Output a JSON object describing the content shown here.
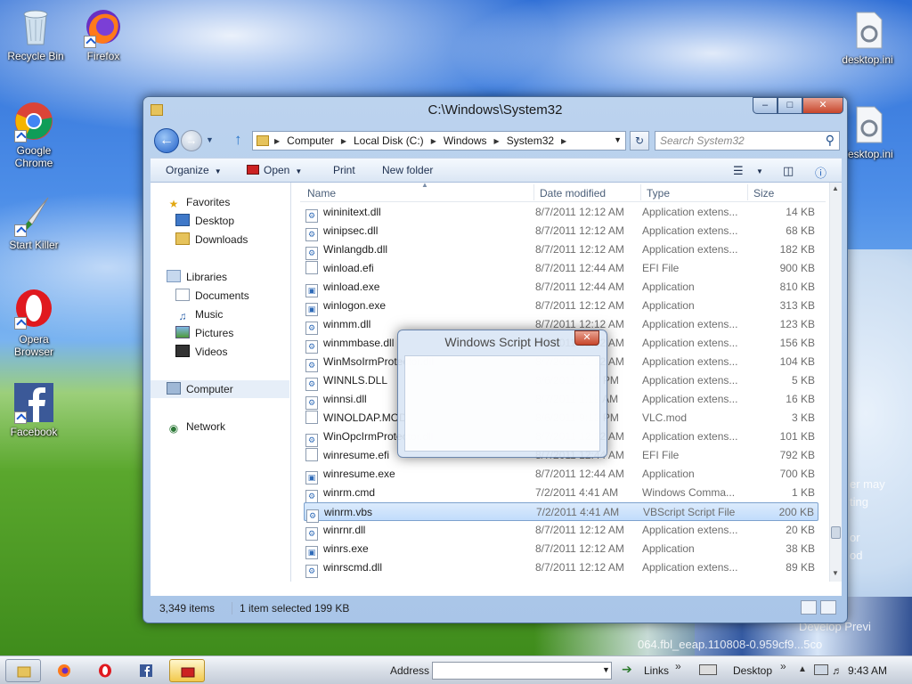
{
  "desktop": {
    "icons": [
      {
        "label": "Recycle Bin"
      },
      {
        "label": "Firefox"
      },
      {
        "label": "Google Chrome"
      },
      {
        "label": "Start Killer"
      },
      {
        "label": "Opera Browser"
      },
      {
        "label": "Facebook"
      },
      {
        "label": "desktop.ini"
      },
      {
        "label": "desktop.ini"
      }
    ],
    "watermark": {
      "line1": "er may",
      "line2": "ting",
      "line3": "or",
      "line4": "od",
      "line5": "Develop Previ",
      "line6": "064.fbl_eeap.110808-0.959cf9...5co"
    }
  },
  "window": {
    "title": "C:\\Windows\\System32",
    "caption": {
      "minimize": "–",
      "maximize": "□",
      "close": "✕"
    },
    "breadcrumb": [
      "Computer",
      "Local Disk (C:)",
      "Windows",
      "System32"
    ],
    "search_placeholder": "Search System32",
    "toolbar": {
      "organize": "Organize",
      "open": "Open",
      "print": "Print",
      "new_folder": "New folder"
    },
    "nav": {
      "favorites": "Favorites",
      "desktop": "Desktop",
      "downloads": "Downloads",
      "libraries": "Libraries",
      "documents": "Documents",
      "music": "Music",
      "pictures": "Pictures",
      "videos": "Videos",
      "computer": "Computer",
      "network": "Network"
    },
    "columns": {
      "name": "Name",
      "date": "Date modified",
      "type": "Type",
      "size": "Size"
    },
    "files": [
      {
        "name": "wininitext.dll",
        "date": "8/7/2011 12:12 AM",
        "type": "Application extens...",
        "size": "14 KB"
      },
      {
        "name": "winipsec.dll",
        "date": "8/7/2011 12:12 AM",
        "type": "Application extens...",
        "size": "68 KB"
      },
      {
        "name": "Winlangdb.dll",
        "date": "8/7/2011 12:12 AM",
        "type": "Application extens...",
        "size": "182 KB"
      },
      {
        "name": "winload.efi",
        "date": "8/7/2011 12:44 AM",
        "type": "EFI File",
        "size": "900 KB"
      },
      {
        "name": "winload.exe",
        "date": "8/7/2011 12:44 AM",
        "type": "Application",
        "size": "810 KB"
      },
      {
        "name": "winlogon.exe",
        "date": "8/7/2011 12:12 AM",
        "type": "Application",
        "size": "313 KB"
      },
      {
        "name": "winmm.dll",
        "date": "8/7/2011 12:12 AM",
        "type": "Application extens...",
        "size": "123 KB"
      },
      {
        "name": "winmmbase.dll",
        "date": "8/7/2011 12:12 AM",
        "type": "Application extens...",
        "size": "156 KB"
      },
      {
        "name": "WinMsoIrmProtector.dll",
        "date": "8/7/2011 12:12 AM",
        "type": "Application extens...",
        "size": "104 KB"
      },
      {
        "name": "WINNLS.DLL",
        "date": "8/6/2011 9:12 PM",
        "type": "Application extens...",
        "size": "5 KB"
      },
      {
        "name": "winnsi.dll",
        "date": "8/7/2011 1:19 AM",
        "type": "Application extens...",
        "size": "16 KB"
      },
      {
        "name": "WINOLDAP.MOD",
        "date": "8/6/2011 9:12 PM",
        "type": "VLC.mod",
        "size": "3 KB"
      },
      {
        "name": "WinOpcIrmProtector.dll",
        "date": "8/7/2011 12:12 AM",
        "type": "Application extens...",
        "size": "101 KB"
      },
      {
        "name": "winresume.efi",
        "date": "8/7/2011 12:44 AM",
        "type": "EFI File",
        "size": "792 KB"
      },
      {
        "name": "winresume.exe",
        "date": "8/7/2011 12:44 AM",
        "type": "Application",
        "size": "700 KB"
      },
      {
        "name": "winrm.cmd",
        "date": "7/2/2011 4:41 AM",
        "type": "Windows Comma...",
        "size": "1 KB"
      },
      {
        "name": "winrm.vbs",
        "date": "7/2/2011 4:41 AM",
        "type": "VBScript Script File",
        "size": "200 KB"
      },
      {
        "name": "winrnr.dll",
        "date": "8/7/2011 12:12 AM",
        "type": "Application extens...",
        "size": "20 KB"
      },
      {
        "name": "winrs.exe",
        "date": "8/7/2011 12:12 AM",
        "type": "Application",
        "size": "38 KB"
      },
      {
        "name": "winrscmd.dll",
        "date": "8/7/2011 12:12 AM",
        "type": "Application extens...",
        "size": "89 KB"
      }
    ],
    "selected_index": 16,
    "status": {
      "items": "3,349 items",
      "selected": "1 item selected  199 KB"
    }
  },
  "dialog": {
    "title": "Windows Script Host",
    "close": "✕"
  },
  "taskbar": {
    "address_label": "Address",
    "links_label": "Links",
    "desktop_label": "Desktop",
    "chevron": "»",
    "clock": "9:43 AM"
  }
}
